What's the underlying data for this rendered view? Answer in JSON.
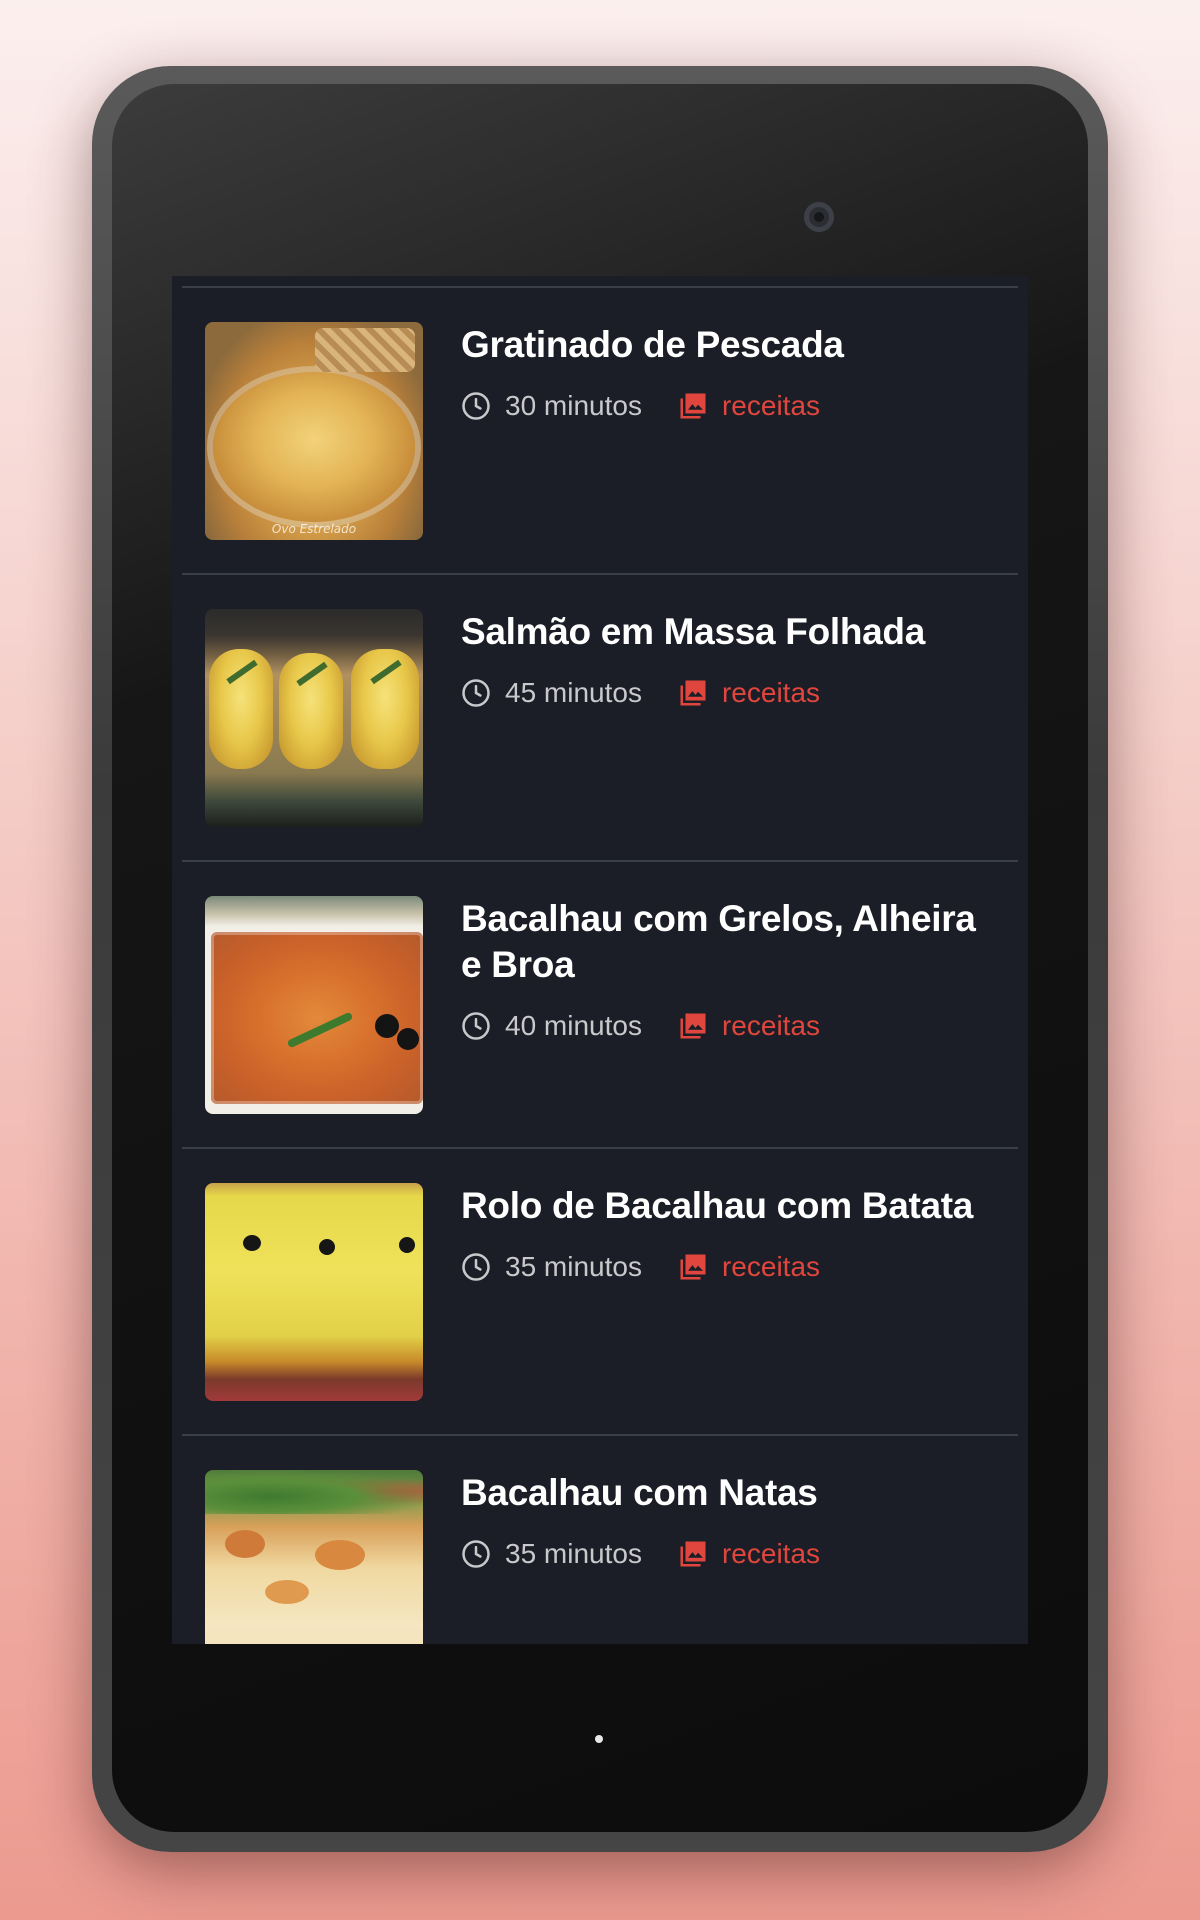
{
  "recipes": [
    {
      "title": "Gratinado de Pescada",
      "time": "30 minutos",
      "category": "receitas",
      "image_caption": "Ovo Estrelado"
    },
    {
      "title": "Salmão em Massa Folhada",
      "time": "45 minutos",
      "category": "receitas"
    },
    {
      "title": "Bacalhau com Grelos, Alheira e Broa",
      "time": "40 minutos",
      "category": "receitas"
    },
    {
      "title": "Rolo de Bacalhau com Batata",
      "time": "35 minutos",
      "category": "receitas"
    },
    {
      "title": "Bacalhau com Natas",
      "time": "35 minutos",
      "category": "receitas"
    }
  ],
  "icons": {
    "time": "clock-icon",
    "category": "image-gallery-icon"
  },
  "colors": {
    "background": "#1b1e26",
    "title": "#ffffff",
    "time_text": "#c9c9cc",
    "category": "#e0463d",
    "divider": "#3b3f49"
  }
}
